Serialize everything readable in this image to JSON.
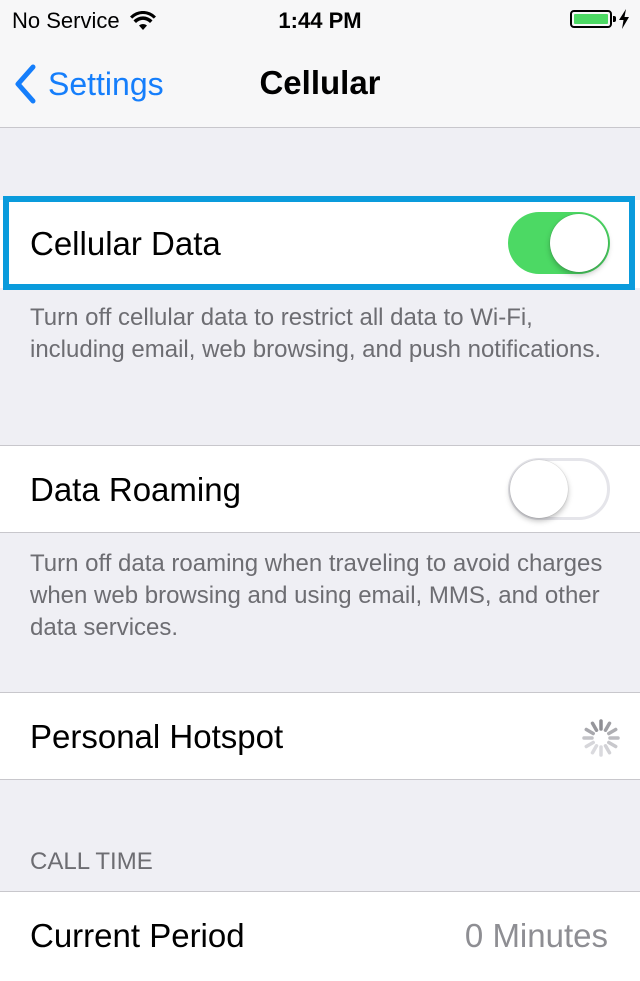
{
  "status_bar": {
    "carrier": "No Service",
    "time": "1:44 PM",
    "wifi_icon": "wifi-icon",
    "battery_color": "#4cd964"
  },
  "nav": {
    "back_label": "Settings",
    "title": "Cellular"
  },
  "cellular_data": {
    "label": "Cellular Data",
    "enabled": true,
    "footer": "Turn off cellular data to restrict all data to Wi-Fi, including email, web browsing, and push notifications."
  },
  "data_roaming": {
    "label": "Data Roaming",
    "enabled": false,
    "footer": "Turn off data roaming when traveling to avoid charges when web browsing and using email, MMS, and other data services."
  },
  "personal_hotspot": {
    "label": "Personal Hotspot",
    "icon": "loading-spinner-icon"
  },
  "call_time": {
    "header": "CALL TIME",
    "current_period_label": "Current Period",
    "current_period_value": "0 Minutes"
  },
  "colors": {
    "accent": "#157efb",
    "switch_on": "#4cd964",
    "highlight": "#0a9bdc",
    "background": "#efeff4"
  }
}
